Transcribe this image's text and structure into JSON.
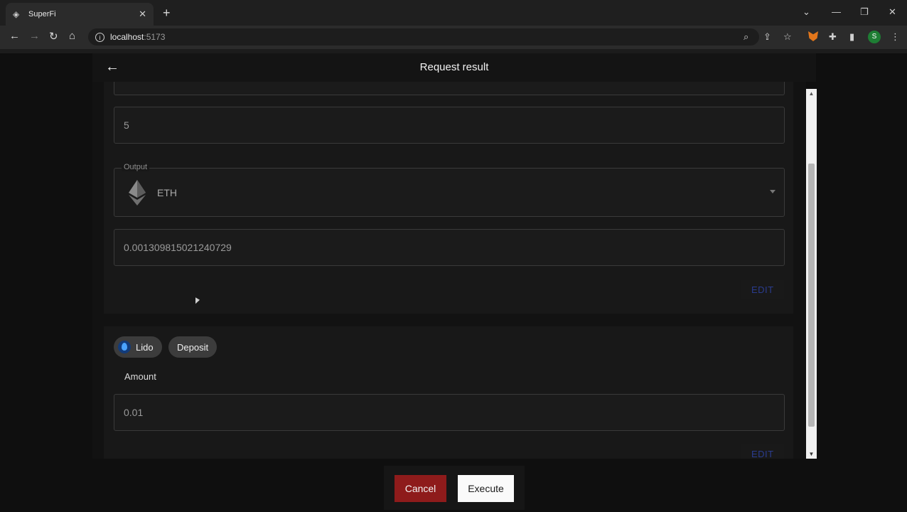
{
  "browser": {
    "tab_title": "SuperFi",
    "url_host": "localhost",
    "url_port": ":5173",
    "profile_initial": "S"
  },
  "header": {
    "title": "Request result"
  },
  "card1": {
    "input_value": "5",
    "output_legend": "Output",
    "output_token": "ETH",
    "output_amount": "0.001309815021240729",
    "edit_label": "EDIT"
  },
  "card2": {
    "protocol_chip": "Lido",
    "action_chip": "Deposit",
    "amount_label": "Amount",
    "amount_value": "0.01",
    "edit_label": "EDIT"
  },
  "footer": {
    "cancel_label": "Cancel",
    "execute_label": "Execute"
  },
  "colors": {
    "cancel": "#8e1b1b",
    "edit": "#2a3c8f",
    "background": "#121212"
  }
}
